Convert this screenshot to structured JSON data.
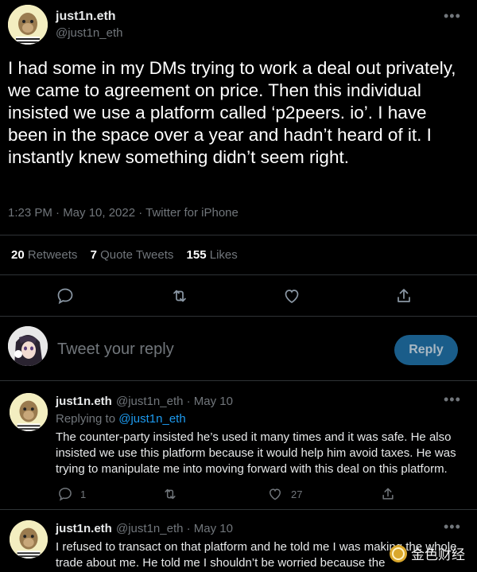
{
  "main_tweet": {
    "display_name": "just1n.eth",
    "handle": "@just1n_eth",
    "text": "I had some in my DMs trying to work a deal out privately, we came to agreement on price. Then this individual insisted we use a platform called ‘p2peers. io’. I have been in the space over a year and hadn’t heard of it. I instantly knew something didn’t seem right.",
    "meta": "1:23 PM · May 10, 2022 · Twitter for iPhone",
    "retweets": "20",
    "retweets_label": "Retweets",
    "quotes": "7",
    "quotes_label": "Quote Tweets",
    "likes": "155",
    "likes_label": "Likes"
  },
  "reply_box": {
    "placeholder": "Tweet your reply",
    "button_label": "Reply"
  },
  "replies": [
    {
      "display_name": "just1n.eth",
      "handle_time": "@just1n_eth · May 10",
      "replying_to_label": "Replying to",
      "replying_to_handle": "@just1n_eth",
      "text": "The counter-party insisted he’s used it many times and it was safe. He also insisted we use this platform because it would help him avoid taxes. He was trying to manipulate me into moving forward with this deal on this platform.",
      "reply_count": "1",
      "like_count": "27"
    },
    {
      "display_name": "just1n.eth",
      "handle_time": "@just1n_eth · May 10",
      "text": "I refused to transact on that platform and he told me I was making the whole trade about me. He told me I shouldn’t be worried because the"
    }
  ],
  "watermark": "金色财经",
  "icons": {
    "more": "more-icon",
    "reply": "reply-icon",
    "retweet": "retweet-icon",
    "like": "heart-icon",
    "share": "share-icon"
  },
  "colors": {
    "background": "#000000",
    "text": "#e7e9ea",
    "muted": "#71767b",
    "accent": "#1d9bf0",
    "divider": "#2f3336"
  }
}
